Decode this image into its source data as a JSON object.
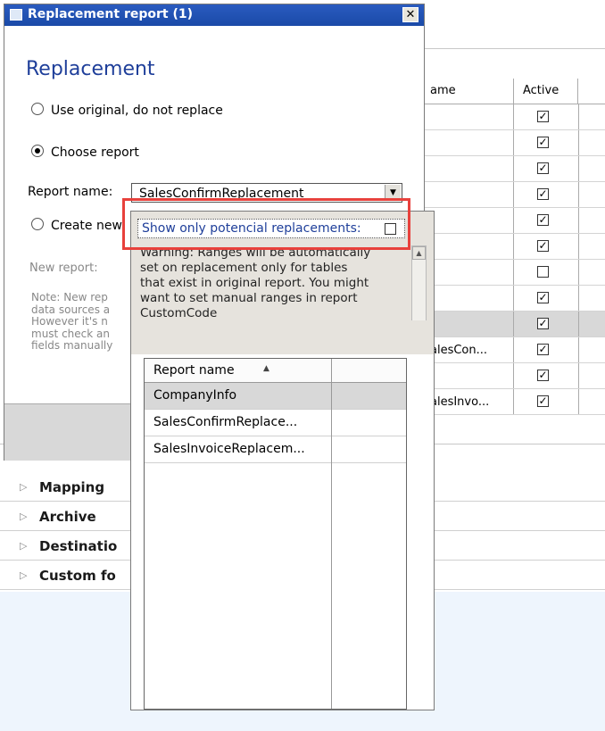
{
  "background": {
    "grid": {
      "headers": {
        "name": "ame",
        "active": "Active"
      },
      "rows": [
        {
          "name": "",
          "active": true
        },
        {
          "name": "",
          "active": true
        },
        {
          "name": "",
          "active": true
        },
        {
          "name": "",
          "active": true
        },
        {
          "name": "",
          "active": true
        },
        {
          "name": "",
          "active": true
        },
        {
          "name": "",
          "active": false
        },
        {
          "name": "",
          "active": true
        },
        {
          "name": "",
          "active": true,
          "selected": true
        },
        {
          "name": "alesCon...",
          "active": true
        },
        {
          "name": "",
          "active": true
        },
        {
          "name": "alesInvo...",
          "active": true
        }
      ]
    },
    "fasttabs": [
      "Mapping",
      "Archive",
      "Destinatio",
      "Custom fo"
    ]
  },
  "dialog": {
    "title": "Replacement report (1)",
    "close_glyph": "✕",
    "heading": "Replacement",
    "option_use_original": "Use original, do not replace",
    "option_choose_report": "Choose report",
    "report_name_label": "Report name:",
    "report_name_value": "SalesConfirmReplacement",
    "option_create_new": "Create new",
    "new_report_label": "New report:",
    "note_text": "Note: New rep\ndata sources a\nHowever it's n\nmust check an\nfields manually"
  },
  "popup": {
    "filter_label": "Show only potencial replacements:",
    "filter_checked": false,
    "warning": "Warning: Ranges will be automatically\nset on replacement only for tables\nthat exist in original report. You might\nwant to set manual ranges in report\nCustomCode",
    "list_header": "Report name",
    "list_rows": [
      "CompanyInfo",
      "SalesConfirmReplace...",
      "SalesInvoiceReplacem..."
    ]
  },
  "colors": {
    "accent": "#1f3f9a",
    "highlight": "#e8413c",
    "titlebar": "#2a5bc0"
  }
}
